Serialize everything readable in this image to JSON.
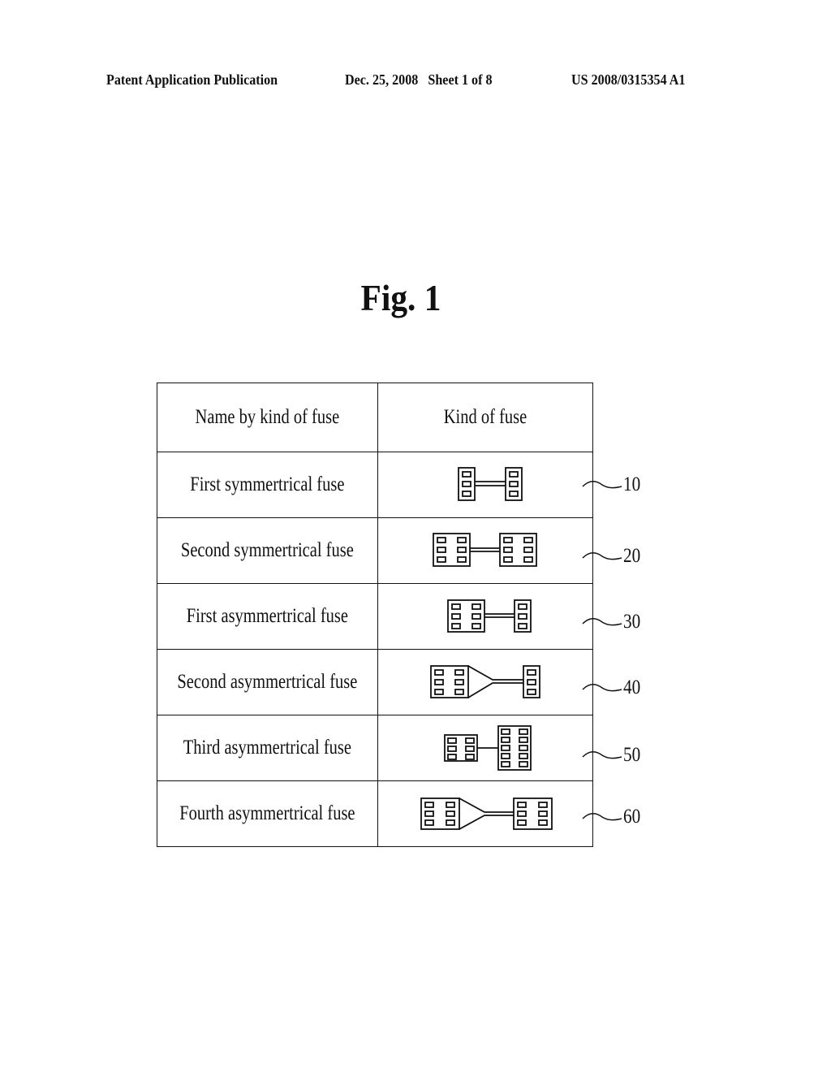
{
  "header": {
    "publication": "Patent Application Publication",
    "date_sheet": "Dec. 25, 2008   Sheet 1 of 8",
    "patent_number": "US 2008/0315354 A1"
  },
  "figure": {
    "title": "Fig. 1",
    "table": {
      "columns": [
        "Name by kind of fuse",
        "Kind of fuse"
      ],
      "rows": [
        {
          "name": "First symmertrical fuse",
          "ref": "10",
          "shape": "first-symmetrical"
        },
        {
          "name": "Second symmertrical fuse",
          "ref": "20",
          "shape": "second-symmetrical"
        },
        {
          "name": "First asymmertrical fuse",
          "ref": "30",
          "shape": "first-asymmetrical"
        },
        {
          "name": "Second asymmertrical fuse",
          "ref": "40",
          "shape": "second-asymmetrical"
        },
        {
          "name": "Third asymmertrical fuse",
          "ref": "50",
          "shape": "third-asymmetrical"
        },
        {
          "name": "Fourth asymmertrical fuse",
          "ref": "60",
          "shape": "fourth-asymmetrical"
        }
      ]
    }
  }
}
